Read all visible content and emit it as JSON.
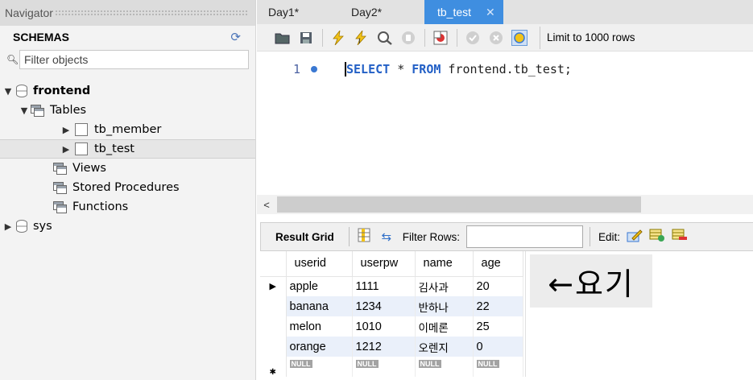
{
  "navigator": {
    "header": "Navigator",
    "schemas_title": "SCHEMAS",
    "filter_placeholder": "Filter objects",
    "tree": {
      "frontend": "frontend",
      "tables": "Tables",
      "tb_member": "tb_member",
      "tb_test": "tb_test",
      "views": "Views",
      "stored_procedures": "Stored Procedures",
      "functions": "Functions",
      "sys": "sys"
    }
  },
  "tabs": [
    {
      "label": "Day1*"
    },
    {
      "label": "Day2*"
    },
    {
      "label": "tb_test",
      "active": true
    }
  ],
  "toolbar": {
    "icons": [
      "open-file-icon",
      "save-icon",
      "execute-icon",
      "execute-current-icon",
      "explain-icon",
      "stop-icon",
      "toggle-error-icon",
      "commit-icon",
      "rollback-icon",
      "autocommit-icon"
    ],
    "limit_label": "Limit to 1000 rows"
  },
  "editor": {
    "line_number": "1",
    "kw1": "SELECT",
    "star": " * ",
    "kw2": "FROM",
    "rest": " frontend.tb_test;"
  },
  "result": {
    "label": "Result Grid",
    "filter_label": "Filter Rows:",
    "filter_value": "",
    "edit_label": "Edit:",
    "columns": [
      "userid",
      "userpw",
      "name",
      "age"
    ],
    "rows": [
      [
        "apple",
        "1111",
        "김사과",
        "20"
      ],
      [
        "banana",
        "1234",
        "반하나",
        "22"
      ],
      [
        "melon",
        "1010",
        "이메론",
        "25"
      ],
      [
        "orange",
        "1212",
        "오렌지",
        "0"
      ]
    ],
    "null_label": "NULL",
    "current_row_marker": "▶",
    "new_row_marker": "✱"
  },
  "annotation": "←요기",
  "colors": {
    "tab_active": "#3f8ee0",
    "keyword": "#2360c6",
    "grid_alt_row": "#eaf0fa"
  }
}
